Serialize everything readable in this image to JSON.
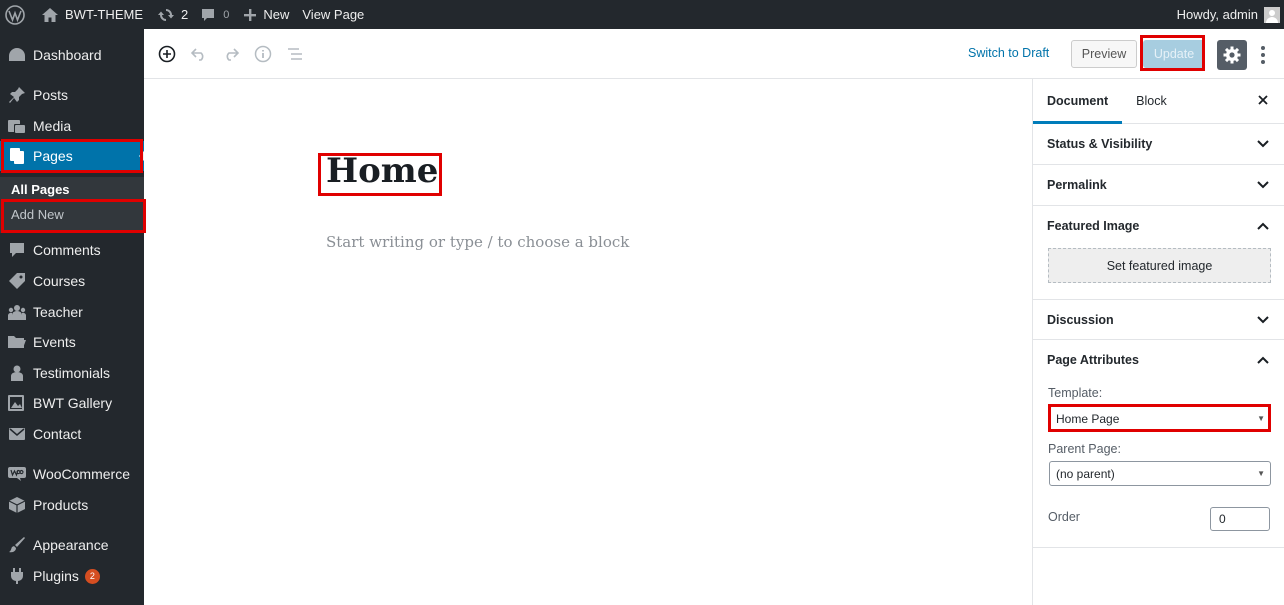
{
  "adminbar": {
    "site_name": "BWT-THEME",
    "updates_count": "2",
    "comments_count": "0",
    "new_label": "New",
    "view_label": "View Page",
    "howdy": "Howdy, admin"
  },
  "sidebar": {
    "items": [
      {
        "label": "Dashboard",
        "icon": "dashboard-icon"
      },
      {
        "label": "Posts",
        "icon": "pin-icon"
      },
      {
        "label": "Media",
        "icon": "media-icon"
      },
      {
        "label": "Pages",
        "icon": "pages-icon"
      },
      {
        "label": "Comments",
        "icon": "comment-icon"
      },
      {
        "label": "Courses",
        "icon": "tag-icon"
      },
      {
        "label": "Teacher",
        "icon": "groups-icon"
      },
      {
        "label": "Events",
        "icon": "folder-icon"
      },
      {
        "label": "Testimonials",
        "icon": "user-icon"
      },
      {
        "label": "BWT Gallery",
        "icon": "gallery-icon"
      },
      {
        "label": "Contact",
        "icon": "email-icon"
      },
      {
        "label": "WooCommerce",
        "icon": "woo-icon"
      },
      {
        "label": "Products",
        "icon": "box-icon"
      },
      {
        "label": "Appearance",
        "icon": "brush-icon"
      },
      {
        "label": "Plugins",
        "icon": "plugin-icon",
        "badge": "2"
      }
    ],
    "submenu": {
      "all_pages": "All Pages",
      "add_new": "Add New"
    }
  },
  "toolbar": {
    "switch_draft": "Switch to Draft",
    "preview": "Preview",
    "update": "Update"
  },
  "editor": {
    "title": "Home",
    "placeholder": "Start writing or type / to choose a block"
  },
  "panel": {
    "tab_document": "Document",
    "tab_block": "Block",
    "status_visibility": "Status & Visibility",
    "permalink": "Permalink",
    "featured_image": "Featured Image",
    "set_featured_image": "Set featured image",
    "discussion": "Discussion",
    "page_attributes": "Page Attributes",
    "template_label": "Template:",
    "template_value": "Home Page",
    "parent_label": "Parent Page:",
    "parent_value": "(no parent)",
    "order_label": "Order",
    "order_value": "0"
  },
  "colors": {
    "admin_dark": "#23282d",
    "accent_blue": "#0073aa",
    "highlight_red": "#e00000"
  }
}
